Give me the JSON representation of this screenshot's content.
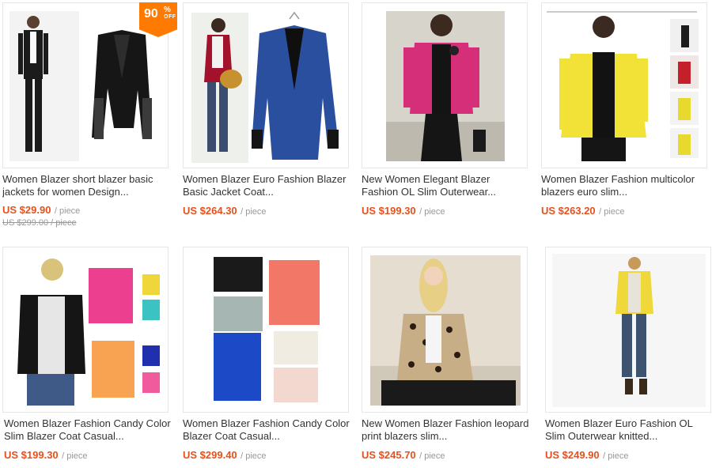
{
  "products": [
    {
      "title": "Women Blazer short blazer basic jackets for women Design...",
      "price": "US $29.90",
      "unit": "/ piece",
      "old_price": "US $299.00 / piece",
      "badge": {
        "number": "90",
        "percent": "%",
        "off": "OFF"
      }
    },
    {
      "title": "Women Blazer Euro Fashion Blazer Basic Jacket Coat...",
      "price": "US $264.30",
      "unit": "/ piece"
    },
    {
      "title": "New Women Elegant Blazer Fashion OL Slim Outerwear...",
      "price": "US $199.30",
      "unit": "/ piece"
    },
    {
      "title": "Women Blazer Fashion multicolor blazers euro slim...",
      "price": "US $263.20",
      "unit": "/ piece"
    },
    {
      "title": "Women Blazer Fashion Candy Color Slim Blazer Coat Casual...",
      "price": "US $199.30",
      "unit": "/ piece"
    },
    {
      "title": "Women Blazer Fashion Candy Color Blazer Coat Casual...",
      "price": "US $299.40",
      "unit": "/ piece"
    },
    {
      "title": "New Women Blazer Fashion leopard print blazers slim...",
      "price": "US $245.70",
      "unit": "/ piece"
    },
    {
      "title": "Women Blazer Euro Fashion OL Slim Outerwear knitted...",
      "price": "US $249.90",
      "unit": "/ piece"
    }
  ],
  "colors": {
    "price": "#e5511d",
    "badge": "#ff7a00",
    "border": "#e6e6e6"
  }
}
